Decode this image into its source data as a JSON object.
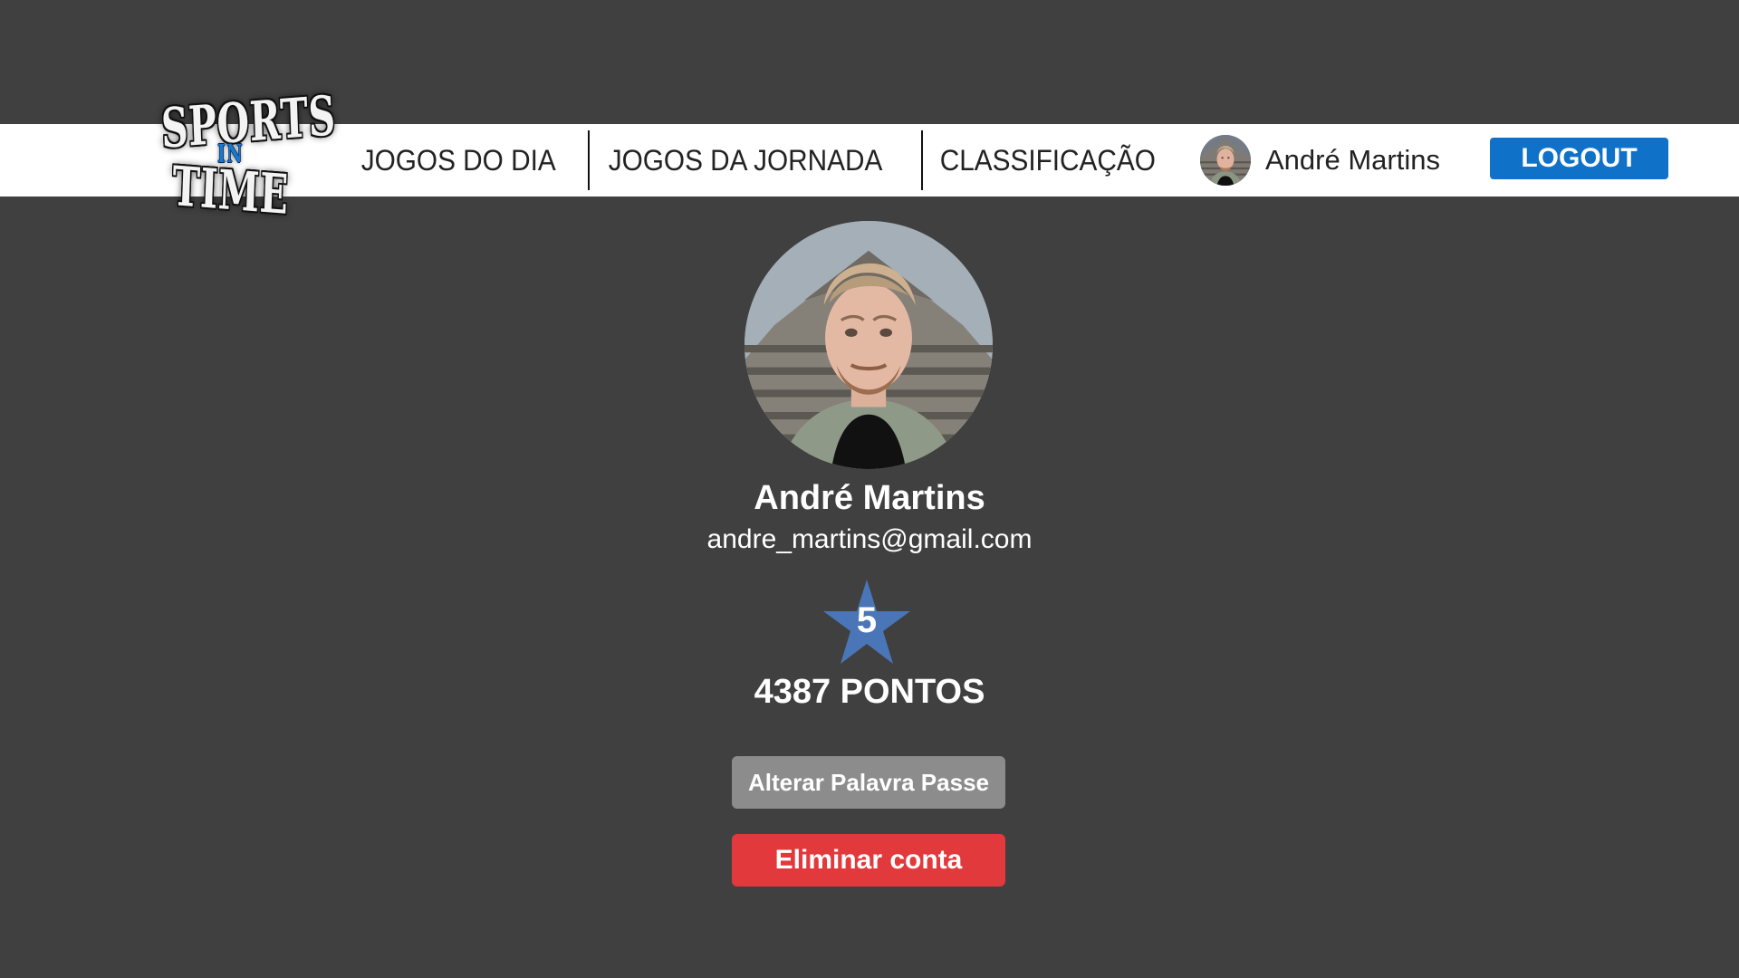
{
  "header": {
    "logo": {
      "line1": "SPORTS",
      "line2": "IN",
      "line3": "TIME"
    },
    "nav": [
      {
        "label": "JOGOS DO DIA"
      },
      {
        "label": "JOGOS DA JORNADA"
      },
      {
        "label": "CLASSIFICAÇÃO"
      }
    ],
    "user": {
      "name": "André Martins",
      "avatar_icon": "profile-photo"
    },
    "logout_label": "LOGOUT"
  },
  "profile": {
    "photo_icon": "profile-photo",
    "name": "André Martins",
    "email": "andre_martins@gmail.com",
    "level": "5",
    "points_text": "4387 PONTOS"
  },
  "actions": {
    "change_password_label": "Alterar Palavra Passe",
    "delete_account_label": "Eliminar conta"
  },
  "colors": {
    "background": "#404040",
    "header": "#ffffff",
    "accent": "#0f72c8",
    "star": "#4a76b8",
    "secondary_button": "#8c8c8c",
    "danger_button": "#e1393c"
  }
}
